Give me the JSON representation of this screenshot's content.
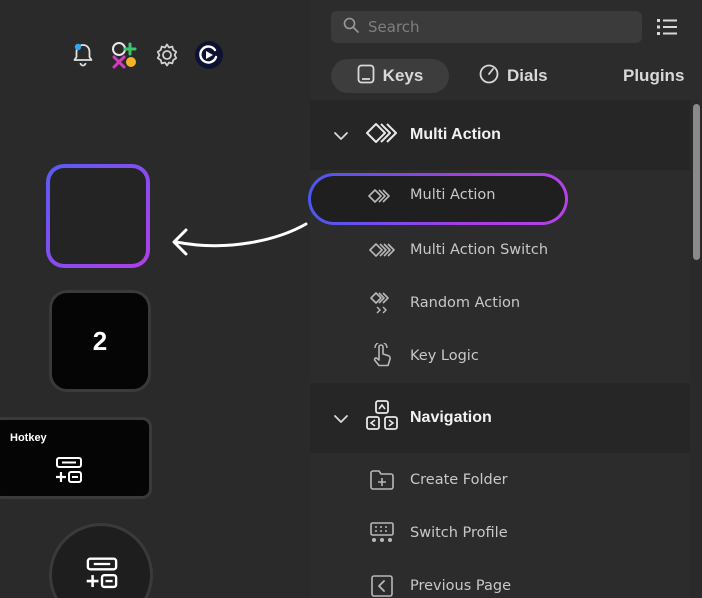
{
  "left": {
    "top_icons": [
      "bell-icon",
      "color-apps-icon",
      "gear-icon",
      "elgato-logo-icon"
    ],
    "keys": {
      "number_label": "2",
      "hotkey_label": "Hotkey"
    }
  },
  "panel": {
    "search_placeholder": "Search",
    "tabs": [
      {
        "label": "Keys",
        "active": true
      },
      {
        "label": "Dials",
        "active": false
      },
      {
        "label": "Plugins",
        "active": false
      }
    ],
    "sections": [
      {
        "title": "Multi Action",
        "expanded": true,
        "items": [
          "Multi Action",
          "Multi Action Switch",
          "Random Action",
          "Key Logic"
        ]
      },
      {
        "title": "Navigation",
        "expanded": true,
        "items": [
          "Create Folder",
          "Switch Profile",
          "Previous Page"
        ]
      }
    ]
  },
  "colors": {
    "accent_gradient_start": "#4c57f0",
    "accent_gradient_end": "#b642e6",
    "background": "#2a2a2a",
    "section_header": "#262626"
  }
}
